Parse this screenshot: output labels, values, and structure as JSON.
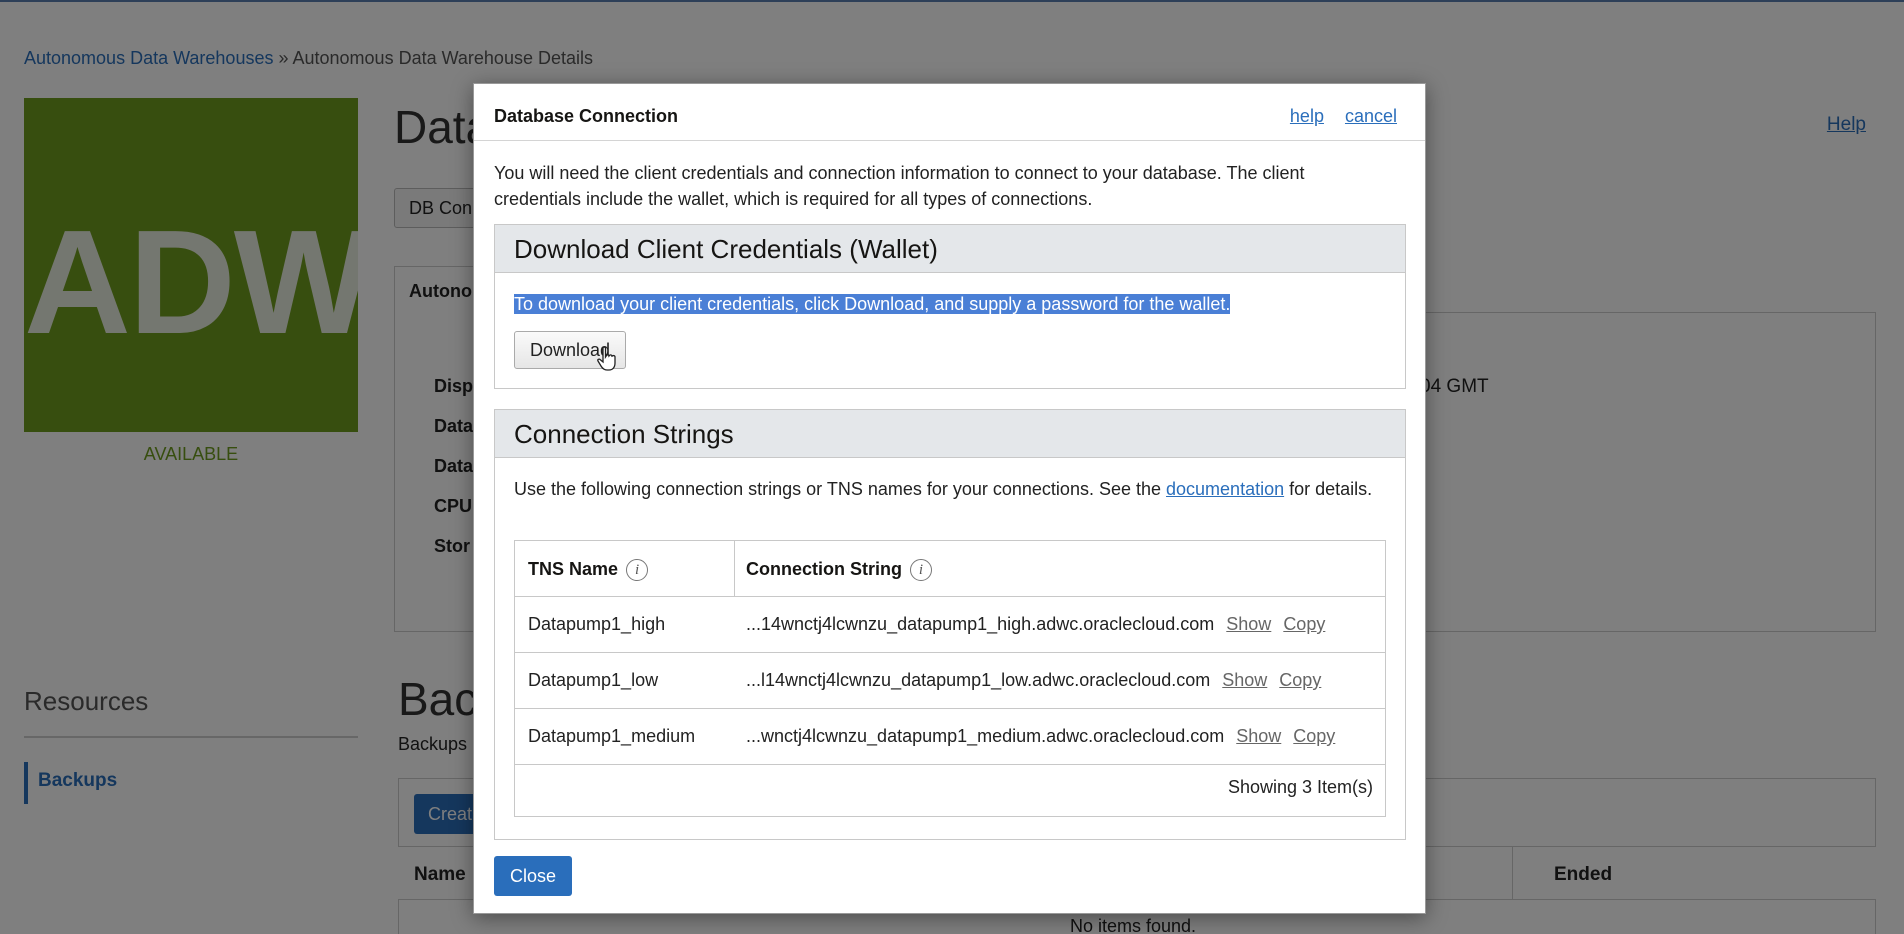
{
  "background": {
    "breadcrumb": {
      "root": "Autonomous Data Warehouses",
      "separator": " » ",
      "current": "Autonomous Data Warehouse Details"
    },
    "logo_text": "ADW",
    "status": "AVAILABLE",
    "page_title": "Data",
    "help_link": "Help",
    "db_actions_button": "DB Con",
    "info_tab": "Autono",
    "info_labels": [
      "Disp",
      "Data",
      "Data",
      "CPU",
      "Stor"
    ],
    "info_value": "04 GMT",
    "resources": {
      "title": "Resources",
      "item": "Backups"
    },
    "backups": {
      "title": "Bac",
      "description": "Backups",
      "create_button": "Creat",
      "col_name": "Name",
      "col_ended": "Ended",
      "empty_text": "No items found."
    }
  },
  "modal": {
    "title": "Database Connection",
    "help_link": "help",
    "cancel_link": "cancel",
    "intro": "You will need the client credentials and connection information to connect to your database. The client credentials include the wallet, which is required for all types of connections.",
    "wallet_section": {
      "heading": "Download Client Credentials (Wallet)",
      "text": "To download your client credentials, click Download, and supply a password for the wallet.",
      "download_button": "Download"
    },
    "connection_section": {
      "heading": "Connection Strings",
      "desc_before": "Use the following connection strings or TNS names for your connections. See the ",
      "desc_link": "documentation",
      "desc_after": " for details.",
      "col_tns": "TNS Name",
      "col_conn": "Connection String",
      "rows": [
        {
          "tns": "Datapump1_high",
          "conn": "...14wnctj4lcwnzu_datapump1_high.adwc.oraclecloud.com",
          "show": "Show",
          "copy": "Copy"
        },
        {
          "tns": "Datapump1_low",
          "conn": "...l14wnctj4lcwnzu_datapump1_low.adwc.oraclecloud.com",
          "show": "Show",
          "copy": "Copy"
        },
        {
          "tns": "Datapump1_medium",
          "conn": "...wnctj4lcwnzu_datapump1_medium.adwc.oraclecloud.com",
          "show": "Show",
          "copy": "Copy"
        }
      ],
      "footer": "Showing 3 Item(s)"
    },
    "close_button": "Close"
  }
}
